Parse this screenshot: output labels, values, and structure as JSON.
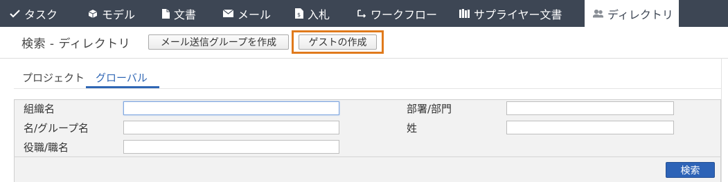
{
  "tabs": [
    {
      "label": "タスク",
      "icon": "check-icon"
    },
    {
      "label": "モデル",
      "icon": "cube-icon"
    },
    {
      "label": "文書",
      "icon": "document-icon"
    },
    {
      "label": "メール",
      "icon": "mail-icon"
    },
    {
      "label": "入札",
      "icon": "bid-icon"
    },
    {
      "label": "ワークフロー",
      "icon": "workflow-icon"
    },
    {
      "label": "サプライヤー文書",
      "icon": "library-icon"
    },
    {
      "label": "ディレクトリ",
      "icon": "users-icon",
      "active": true
    }
  ],
  "header": {
    "title": "検索 - ディレクトリ",
    "create_group_label": "メール送信グループを作成",
    "create_guest_label": "ゲストの作成"
  },
  "subtabs": [
    {
      "label": "プロジェクト"
    },
    {
      "label": "グローバル",
      "active": true
    }
  ],
  "form": {
    "org_name_label": "組織名",
    "first_name_label": "名/グループ名",
    "job_title_label": "役職/職名",
    "department_label": "部署/部門",
    "last_name_label": "姓",
    "org_name_value": "",
    "first_name_value": "",
    "job_title_value": "",
    "department_value": "",
    "last_name_value": ""
  },
  "search_label": "検索",
  "colors": {
    "tabbar_bg": "#3d4654",
    "accent": "#2f66b4",
    "highlight": "#e07a1c",
    "primary_button": "#2d63b7"
  }
}
